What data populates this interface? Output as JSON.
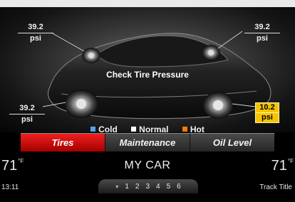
{
  "screen": {
    "warning": "Check Tire Pressure",
    "tires": {
      "front_left": {
        "value": "39.2",
        "unit": "psi"
      },
      "front_right": {
        "value": "39.2",
        "unit": "psi"
      },
      "rear_left": {
        "value": "39.2",
        "unit": "psi"
      },
      "rear_right": {
        "value": "10.2",
        "unit": "psi",
        "status": "hot"
      }
    },
    "legend": [
      {
        "label": "Cold",
        "color": "#4fa6e8"
      },
      {
        "label": "Normal",
        "color": "#ffffff"
      },
      {
        "label": "Hot",
        "color": "#ff7a00"
      }
    ]
  },
  "tabs": [
    {
      "label": "Tires",
      "active": true
    },
    {
      "label": "Maintenance"
    },
    {
      "label": "Oil Level"
    }
  ],
  "status": {
    "temp_left": "71",
    "temp_right": "71",
    "temp_unit": "°F",
    "title": "MY CAR",
    "time": "13:11",
    "track": "Track Title"
  },
  "pager": {
    "pages": [
      "1",
      "2",
      "3",
      "4",
      "5",
      "6"
    ]
  },
  "colors": {
    "active_tab": "#d40000",
    "hot_highlight": "#f5c400"
  }
}
